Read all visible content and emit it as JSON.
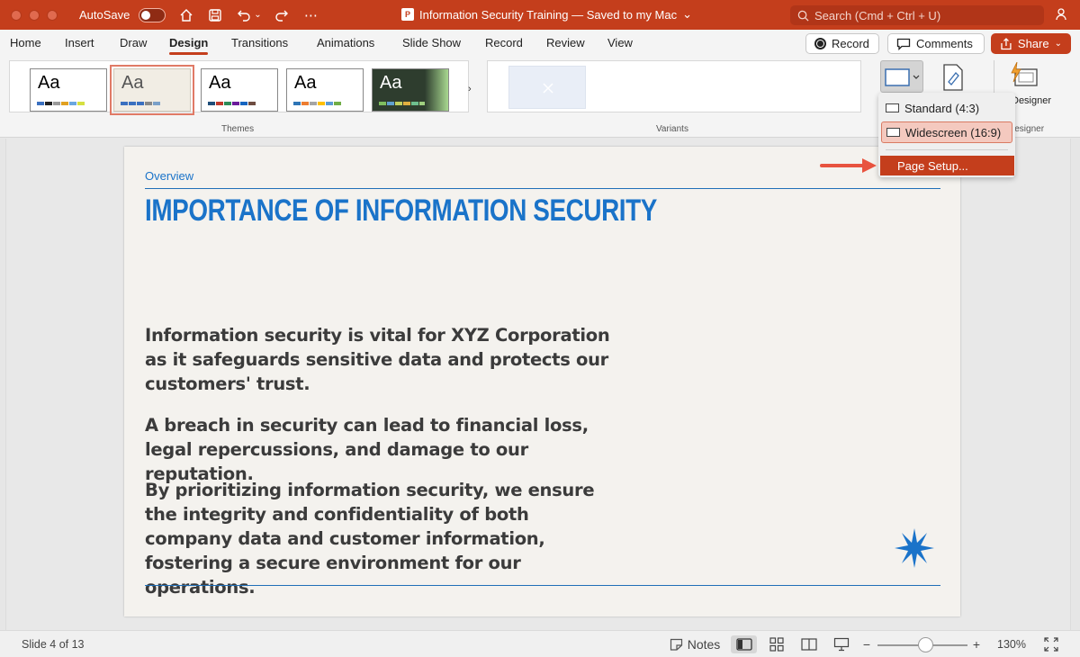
{
  "titlebar": {
    "autosave_label": "AutoSave",
    "doc_title": "Information Security Training — Saved to my Mac",
    "doc_title_chevron": "⌄",
    "search_placeholder": "Search (Cmd + Ctrl + U)",
    "icons": [
      "home-icon",
      "save-icon",
      "undo-icon",
      "redo-icon",
      "more-icon",
      "search-icon",
      "share-person-icon"
    ]
  },
  "ribbon_tabs": [
    "Home",
    "Insert",
    "Draw",
    "Design",
    "Transitions",
    "Animations",
    "Slide Show",
    "Record",
    "Review",
    "View"
  ],
  "active_tab": "Design",
  "actions": {
    "record_label": "Record",
    "comments_label": "Comments",
    "share_label": "Share"
  },
  "groups": {
    "themes_label": "Themes",
    "variants_label": "Variants",
    "designer_label": "Designer",
    "designer_group_label": "Designer"
  },
  "themes": [
    {
      "aa": "Aa",
      "bg": "#ffffff",
      "fg": "#000000",
      "swatches": [
        "#3a70c0",
        "#222222",
        "#999999",
        "#e0a020",
        "#6aa7e0",
        "#d6e040"
      ]
    },
    {
      "aa": "Aa",
      "bg": "#f1ede4",
      "fg": "#555555",
      "swatches": [
        "#3a70c0",
        "#3a70c0",
        "#3a70c0",
        "#888888",
        "#7aa0c8"
      ]
    },
    {
      "aa": "Aa",
      "bg": "#ffffff",
      "fg": "#000000",
      "swatches": [
        "#1f4e79",
        "#c0392b",
        "#2e8b57",
        "#6a1b9a",
        "#1565c0",
        "#6d4c41"
      ]
    },
    {
      "aa": "Aa",
      "bg": "#ffffff",
      "fg": "#000000",
      "swatches": [
        "#2e75b6",
        "#ed7d31",
        "#a5a5a5",
        "#ffc000",
        "#5b9bd5",
        "#70ad47"
      ]
    },
    {
      "aa": "Aa",
      "bg": "#2e3d2e",
      "fg": "#ffffff",
      "swatches": [
        "#7fbf5f",
        "#5fa0d0",
        "#c0d060",
        "#e0b040",
        "#6fbf8f",
        "#9fcf7f"
      ]
    }
  ],
  "dropdown": {
    "standard_label": "Standard (4:3)",
    "widescreen_label": "Widescreen (16:9)",
    "page_setup_label": "Page Setup..."
  },
  "slide": {
    "section_label": "Overview",
    "title": "IMPORTANCE OF INFORMATION SECURITY",
    "paragraphs": [
      "Information security is vital for XYZ Corporation as it safeguards sensitive data and protects our customers' trust.",
      "A breach in security can lead to financial loss, legal repercussions, and damage to our reputation.",
      "By prioritizing information security, we ensure the integrity and confidentiality of both company data and customer information, fostering a secure environment for our operations."
    ],
    "accent_color": "#1a73c9"
  },
  "status": {
    "slide_indicator": "Slide 4 of 13",
    "notes_label": "Notes",
    "zoom_minus": "−",
    "zoom_plus": "+",
    "zoom_level": "130%"
  },
  "colors": {
    "brand": "#c43e1c",
    "arrow": "#e8533f"
  }
}
